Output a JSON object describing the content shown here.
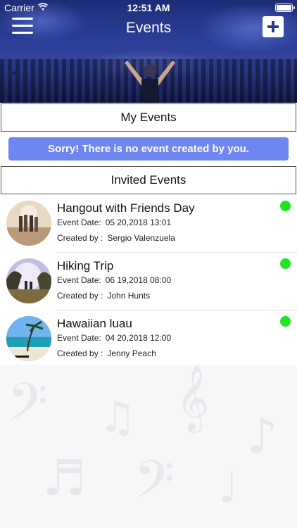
{
  "status_bar": {
    "carrier": "Carrier",
    "time": "12:51 AM"
  },
  "nav": {
    "title": "Events",
    "menu_icon": "hamburger-menu-icon",
    "add_icon": "plus-icon"
  },
  "my_events": {
    "header": "My Events",
    "empty_message": "Sorry! There is no event created by you."
  },
  "invited_events": {
    "header": "Invited Events",
    "date_label": "Event Date:",
    "creator_label": "Created by :",
    "items": [
      {
        "name": "Hangout with Friends Day",
        "date": "05 20,2018 13:01",
        "creator": "Sergio Valenzuela",
        "status_color": "#1ee61e"
      },
      {
        "name": "Hiking Trip",
        "date": "06 19,2018 08:00",
        "creator": "John Hunts",
        "status_color": "#1ee61e"
      },
      {
        "name": "Hawaiian luau",
        "date": "04 20,2018 12:00",
        "creator": "Jenny Peach",
        "status_color": "#1ee61e"
      }
    ]
  },
  "colors": {
    "accent": "#6d86f0",
    "header_bg": "#2b3e98",
    "status_online": "#1ee61e"
  }
}
